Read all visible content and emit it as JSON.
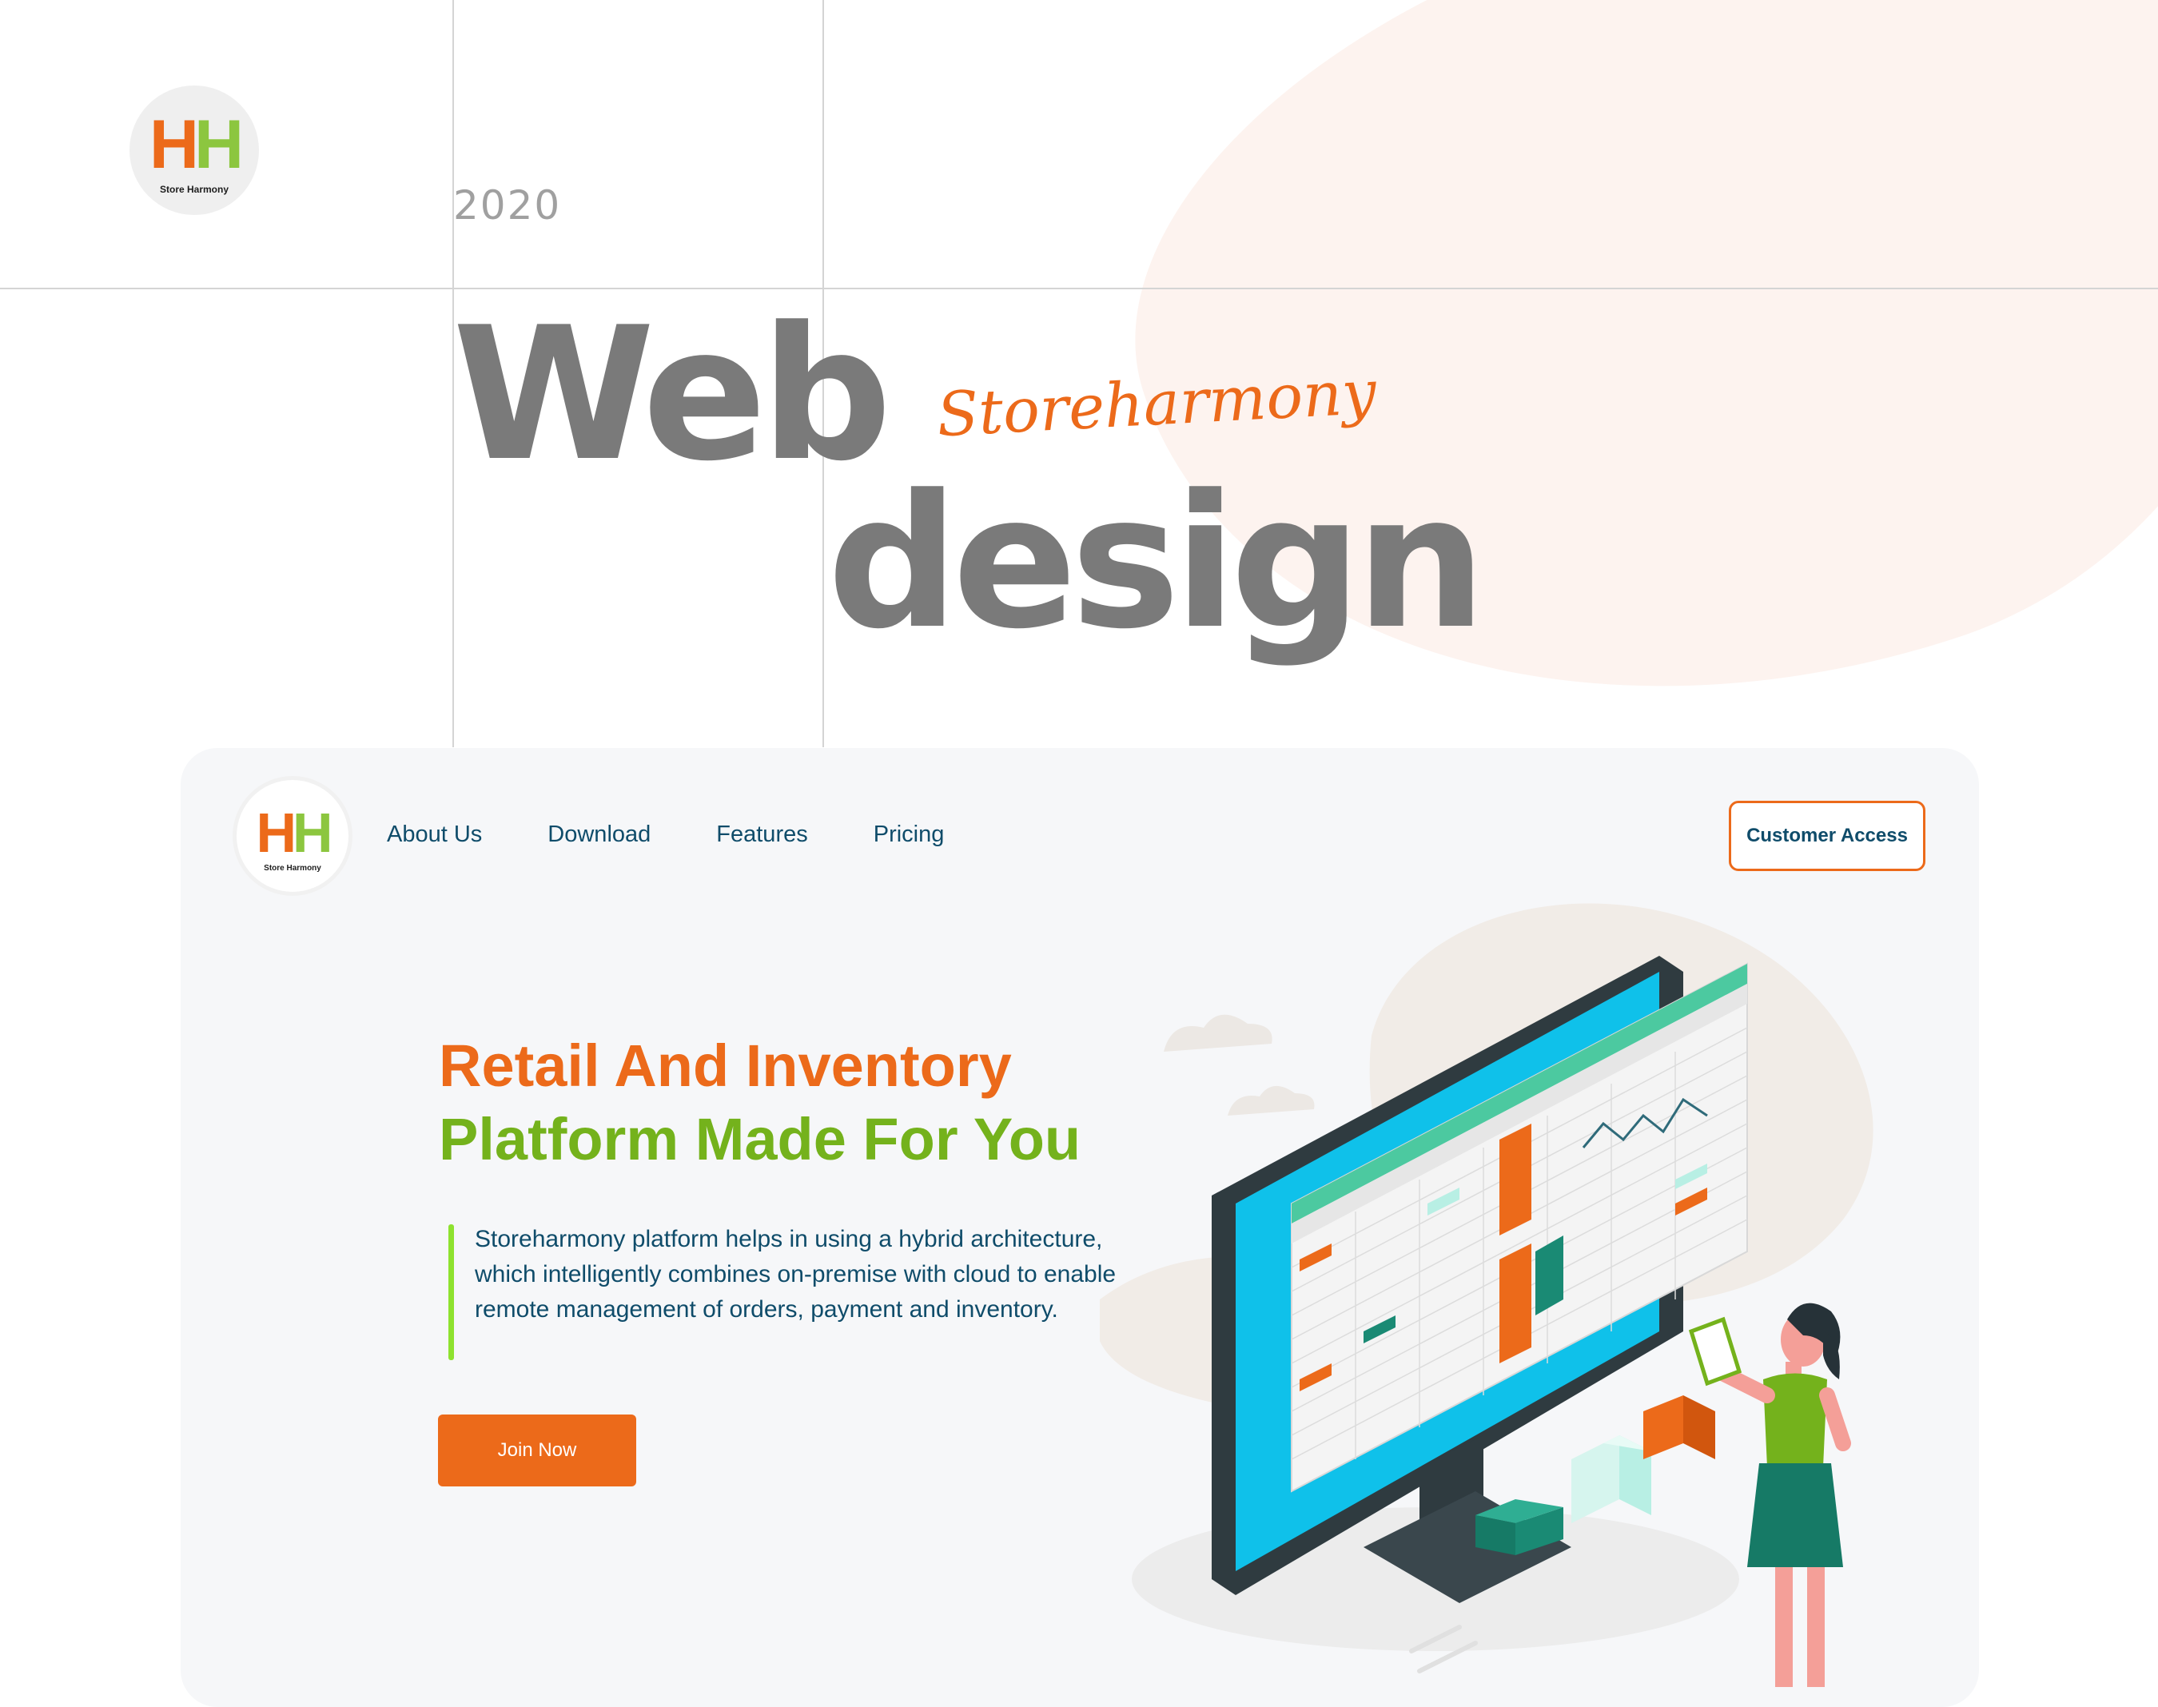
{
  "cover": {
    "logo": {
      "mark_left": "H",
      "mark_right": "H",
      "name": "Store Harmony"
    },
    "year": "2020",
    "title_word_1": "Web",
    "title_word_2": "design",
    "script_brand": "Storeharmony"
  },
  "site": {
    "logo": {
      "mark_left": "H",
      "mark_right": "H",
      "name": "Store Harmony"
    },
    "nav": [
      {
        "label": "About Us"
      },
      {
        "label": "Download"
      },
      {
        "label": "Features"
      },
      {
        "label": "Pricing"
      }
    ],
    "customer_access_label": "Customer Access",
    "hero": {
      "title_line_1": "Retail And Inventory",
      "title_line_2": "Platform Made For You",
      "description": "Storeharmony platform helps in using a hybrid architecture, which intelligently combines on-premise with cloud to enable remote  management of orders, payment and inventory.",
      "cta_label": "Join Now"
    }
  },
  "colors": {
    "brand_orange": "#ec6a1a",
    "brand_green": "#74b21c",
    "nav_text": "#0f4c6a",
    "accent_bar": "#8ee22f",
    "panel_bg": "#f6f7f9"
  }
}
